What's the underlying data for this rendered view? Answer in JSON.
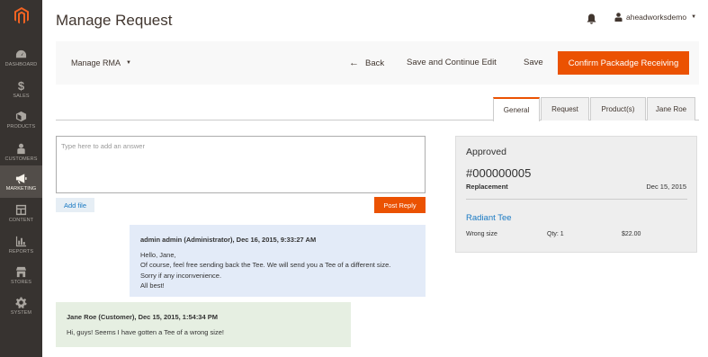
{
  "sidebar": {
    "items": [
      {
        "label": "Dashboard",
        "icon": "dashboard-icon"
      },
      {
        "label": "Sales",
        "icon": "dollar-icon"
      },
      {
        "label": "Products",
        "icon": "cube-icon"
      },
      {
        "label": "Customers",
        "icon": "person-icon"
      },
      {
        "label": "Marketing",
        "icon": "megaphone-icon"
      },
      {
        "label": "Content",
        "icon": "layout-icon"
      },
      {
        "label": "Reports",
        "icon": "bar-chart-icon"
      },
      {
        "label": "Stores",
        "icon": "store-icon"
      },
      {
        "label": "System",
        "icon": "gear-icon"
      }
    ],
    "active": "Marketing"
  },
  "header": {
    "title": "Manage Request",
    "username": "aheadworksdemo"
  },
  "toolbar": {
    "menu_label": "Manage RMA",
    "back_label": "Back",
    "save_continue_label": "Save and Continue Edit",
    "save_label": "Save",
    "confirm_label": "Confirm Packadge Receiving"
  },
  "tabs": [
    "General",
    "Request",
    "Product(s)",
    "Jane Roe"
  ],
  "reply": {
    "placeholder": "Type here to add an answer",
    "add_file_label": "Add file",
    "post_label": "Post Reply"
  },
  "messages": [
    {
      "author": "admin admin (Administrator), Dec 16, 2015, 9:33:27 AM",
      "lines": [
        "Hello, Jane,",
        "Of course, feel free sending back the Tee. We will send you a Tee of a different size.",
        "Sorry if any inconvenience.",
        "All best!"
      ]
    },
    {
      "author": "Jane Roe (Customer), Dec 15, 2015, 1:54:34 PM",
      "lines": [
        "Hi, guys! Seems I have gotten a Tee of a wrong size!"
      ]
    }
  ],
  "summary": {
    "status": "Approved",
    "rma_number": "#000000005",
    "type": "Replacement",
    "date": "Dec 15, 2015",
    "product_name": "Radiant Tee",
    "reason": "Wrong size",
    "qty": "Qty: 1",
    "price": "$22.00"
  },
  "colors": {
    "accent": "#eb5202",
    "sidebar_bg": "#373330",
    "link": "#1979c3"
  }
}
